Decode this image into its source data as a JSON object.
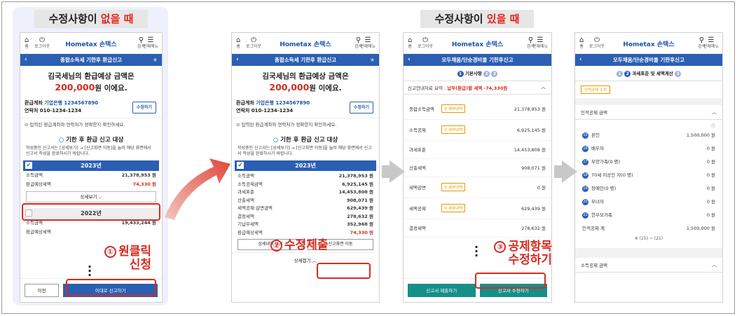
{
  "headings": {
    "left": {
      "pre": "수정사항이 ",
      "hl": "없을 때"
    },
    "right": {
      "pre": "수정사항이 ",
      "hl": "있을 때"
    }
  },
  "topbar": {
    "home": "홈",
    "logout": "로그아웃",
    "logo": "Hometax 손택스",
    "search": "검색",
    "menu": "전체메뉴",
    "home_glyph": "⌂",
    "logout_glyph": "⏻",
    "search_glyph": "⚲",
    "menu_glyph": "☰"
  },
  "screen1": {
    "nav_title": "종합소득세 기한후 환급신고",
    "refund_line1": "김국세님의 환급예상 금액은",
    "refund_amount": "200,000",
    "refund_suffix": "원 이에요.",
    "account_label": "환급계좌",
    "account_value": "기업은행 1234567890",
    "phone_label": "연락처",
    "phone_value": "010-1234-1234",
    "edit_button": "수정하기",
    "notice": "입력된 환급계좌와 연락처가 정확한지 확인하세요.",
    "target_title": "기한 후 환급 신고 대상",
    "target_desc": "작성중인 신고서는 [상세보기] → [신고화면 이동]을 눌러 해당 화면에서 신고서 작성을 완료하시기 바랍니다.",
    "year1": "2023년",
    "year1_rows": [
      {
        "label": "소득금액",
        "value": "21,378,953 원"
      },
      {
        "label": "환급예상세액",
        "value": "74,330 원"
      }
    ],
    "detail_button": "상세보기",
    "year2": "2022년",
    "year2_rows": [
      {
        "label": "소득금액",
        "value": "19,433,244 원"
      },
      {
        "label": "환급예상세액",
        "value": ""
      }
    ],
    "prev_button": "이전",
    "submit_button": "이대로 신고하기"
  },
  "screen2": {
    "nav_title": "종합소득세 기한후 환급신고",
    "year1": "2023년",
    "rows": [
      {
        "label": "소득금액",
        "value": "21,378,953 원"
      },
      {
        "label": "소득공제금액",
        "value": "6,925,145 원"
      },
      {
        "label": "과세표준",
        "value": "14,453,808 원"
      },
      {
        "label": "산출세액",
        "value": "908,071 원"
      },
      {
        "label": "세액공제·감면금액",
        "value": "629,439 원"
      },
      {
        "label": "결정세액",
        "value": "278,632 원"
      },
      {
        "label": "기납부세액",
        "value": "352,968 원"
      },
      {
        "label": "환급예상세액",
        "value": "74,330 원"
      }
    ],
    "detail_button": "상세내역 보기",
    "move_button": "신고화면 이동",
    "collapse": "상세접기"
  },
  "screen3": {
    "nav_title": "모두채움/단순경비율 기한후신고",
    "step_label": "기본사항",
    "summary_pre": "신고안내자료 요약 : ",
    "summary_red": "납부(환급)할 세액 -74,330원",
    "detail_chip": "세부내역",
    "rows": [
      {
        "label": "종합소득금액",
        "value": "21,378,953 원"
      },
      {
        "label": "소득공제",
        "value": "6,925,145 원"
      },
      {
        "label": "과세표준",
        "value": "14,453,808 원"
      },
      {
        "label": "산출세액",
        "value": "908,071 원"
      },
      {
        "label": "세액감면",
        "value": "0 원"
      },
      {
        "label": "세액공제",
        "value": "629,439 원"
      },
      {
        "label": "결정세액",
        "value": "278,632 원"
      }
    ],
    "submit_button": "신고서 제출하기",
    "edit_button": "신고서 수정하기"
  },
  "screen4": {
    "nav_title": "모두채움/단순경비율 기한후신고",
    "step_label": "과세표준 및 세액계산",
    "chip": "인적공제 수정",
    "section1": "인적공제 금액",
    "items": [
      {
        "label": "본인",
        "value": "1,500,000 원"
      },
      {
        "label": "배우자",
        "value": "0 원"
      },
      {
        "label": "부양가족(0 명)",
        "value": "0 원"
      },
      {
        "label": "70세 이상인 자(0 명)",
        "value": "0 원"
      },
      {
        "label": "장애인(0 명)",
        "value": "0 원"
      },
      {
        "label": "부녀자",
        "value": "0 원"
      },
      {
        "label": "한부모가족",
        "value": "0 원"
      }
    ],
    "total_label": "인적공제 계",
    "total_value": "1,500,000 원",
    "formula": "※ (15) ~ (21)",
    "section2": "소득공제 금액"
  },
  "annotations": {
    "a1_num": "①",
    "a1_line1": "원클릭",
    "a1_line2": "신청",
    "a2_num": "②",
    "a2_text": "수정제출",
    "a3_num": "③",
    "a3_line1": "공제항목",
    "a3_line2": "수정하기"
  },
  "colors": {
    "accent": "#2b5fb3",
    "red": "#d62b20",
    "teal": "#168f88",
    "orange": "#e69a00"
  }
}
